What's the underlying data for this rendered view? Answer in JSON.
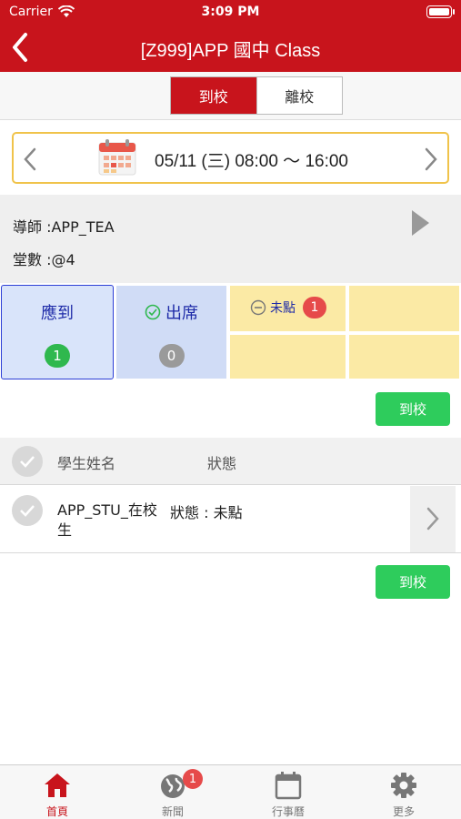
{
  "status_bar": {
    "carrier": "Carrier",
    "time": "3:09 PM",
    "battery_level": 1.0
  },
  "nav": {
    "title": "[Z999]APP 國中 Class"
  },
  "segment": {
    "options": [
      "到校",
      "離校"
    ],
    "selected": "到校"
  },
  "date": {
    "text": "05/11 (三) 08:00 ～ 16:00"
  },
  "info": {
    "teacher": "導師 :APP_TEA",
    "sessions": "堂數 :@4"
  },
  "stats": {
    "expected": {
      "label": "應到",
      "count": "1"
    },
    "present": {
      "label": "出席",
      "count": "0"
    },
    "unmarked": {
      "label": "未點",
      "count": "1"
    }
  },
  "buttons": {
    "arrive_top": "到校",
    "arrive_bottom": "到校"
  },
  "table": {
    "headers": {
      "name": "學生姓名",
      "status": "狀態"
    },
    "rows": [
      {
        "name": "APP_STU_在校生",
        "status": "狀態 : 未點"
      }
    ]
  },
  "tabbar": {
    "items": [
      {
        "label": "首頁",
        "icon": "home-icon",
        "active": true
      },
      {
        "label": "新聞",
        "icon": "globe-icon",
        "badge": "1"
      },
      {
        "label": "行事曆",
        "icon": "calendar-icon"
      },
      {
        "label": "更多",
        "icon": "gear-icon"
      }
    ]
  },
  "colors": {
    "brand": "#c8141c",
    "accent_green": "#2ecc5c",
    "date_border": "#f0c34a"
  }
}
